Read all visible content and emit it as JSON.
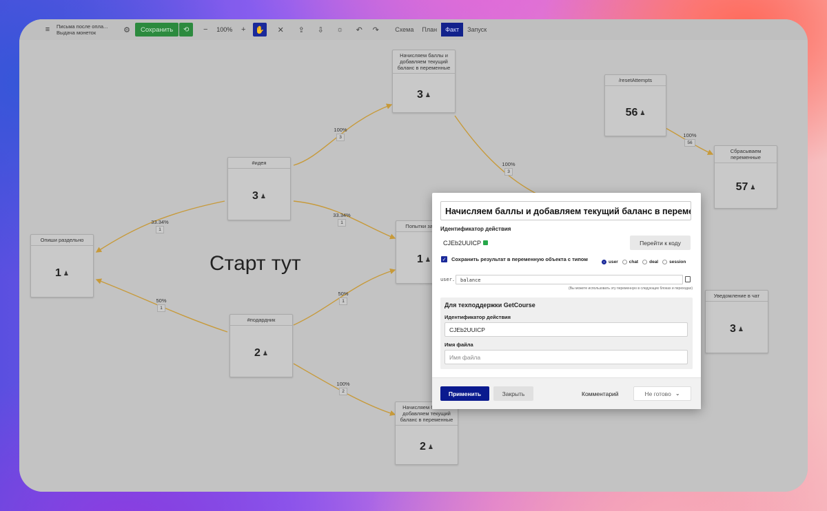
{
  "toolbar": {
    "menu_icon": "≡",
    "title_line1": "Письма после опла...",
    "title_line2": "Выдача монеток",
    "gear_icon": "⚙",
    "save_label": "Сохранить",
    "history_icon": "⟲",
    "zoom_out": "−",
    "zoom_level": "100%",
    "zoom_in": "+",
    "hand_icon": "✋",
    "cut_icon": "✕",
    "upload_icon": "⇪",
    "download_icon": "⇩",
    "bulb_icon": "☼",
    "undo_icon": "↶",
    "redo_icon": "↷",
    "tabs": [
      "Схема",
      "План",
      "Факт",
      "Запуск"
    ]
  },
  "canvas": {
    "start_text": "Старт тут",
    "nodes": {
      "split": {
        "title": "Опиши раздельно",
        "count": "1"
      },
      "idea": {
        "title": "#идея",
        "count": "3"
      },
      "points_top": {
        "title": "Начисляем баллы и добавляем текущий баланс в переменные",
        "count": "3"
      },
      "attempts": {
        "title": "Попытки зако...",
        "count": "1"
      },
      "gift": {
        "title": "#подардник",
        "count": "2"
      },
      "points_bottom": {
        "title": "Начисляем баллы и добавляем текущий баланс в переменные",
        "count": "2"
      },
      "reset": {
        "title": "/resetAttempts",
        "count": "56"
      },
      "reset_vars": {
        "title": "Сбрасываем переменные",
        "count": "57"
      },
      "notify": {
        "title": "Уведомление в чат",
        "count": "3"
      }
    },
    "labels": {
      "l1": {
        "pct": "33.34%",
        "cnt": "1"
      },
      "l2": {
        "pct": "50%",
        "cnt": "1"
      },
      "l3": {
        "pct": "100%",
        "cnt": "3"
      },
      "l4": {
        "pct": "33.34%",
        "cnt": "1"
      },
      "l5": {
        "pct": "50%",
        "cnt": "1"
      },
      "l6": {
        "pct": "100%",
        "cnt": "2"
      },
      "l7": {
        "pct": "100%",
        "cnt": "3"
      },
      "l8": {
        "pct": "100%",
        "cnt": "56"
      }
    },
    "user_icon": "♟"
  },
  "modal": {
    "title": "Начисляем баллы и добавляем текущий баланс в переменные",
    "action_id_label": "Идентификатор действия",
    "action_id": "CJEb2UUICP",
    "goto_code": "Перейти к коду",
    "save_result_label": "Сохранить результат в переменную объекта с типом",
    "types": [
      "user",
      "chat",
      "deal",
      "session"
    ],
    "user_prefix": "user.",
    "var_value": "balance",
    "hint": "(Вы можете использовать эту переменную в следующих блоках и переходах)",
    "support": {
      "title": "Для техподдержки GetCourse",
      "id_label": "Идентификатор действия",
      "id_value": "CJEb2UUICP",
      "file_label": "Имя файла",
      "file_placeholder": "Имя файла"
    },
    "apply": "Применить",
    "close": "Закрыть",
    "comment": "Комментарий",
    "status": "Не готово",
    "status_chevron": "⌄"
  }
}
